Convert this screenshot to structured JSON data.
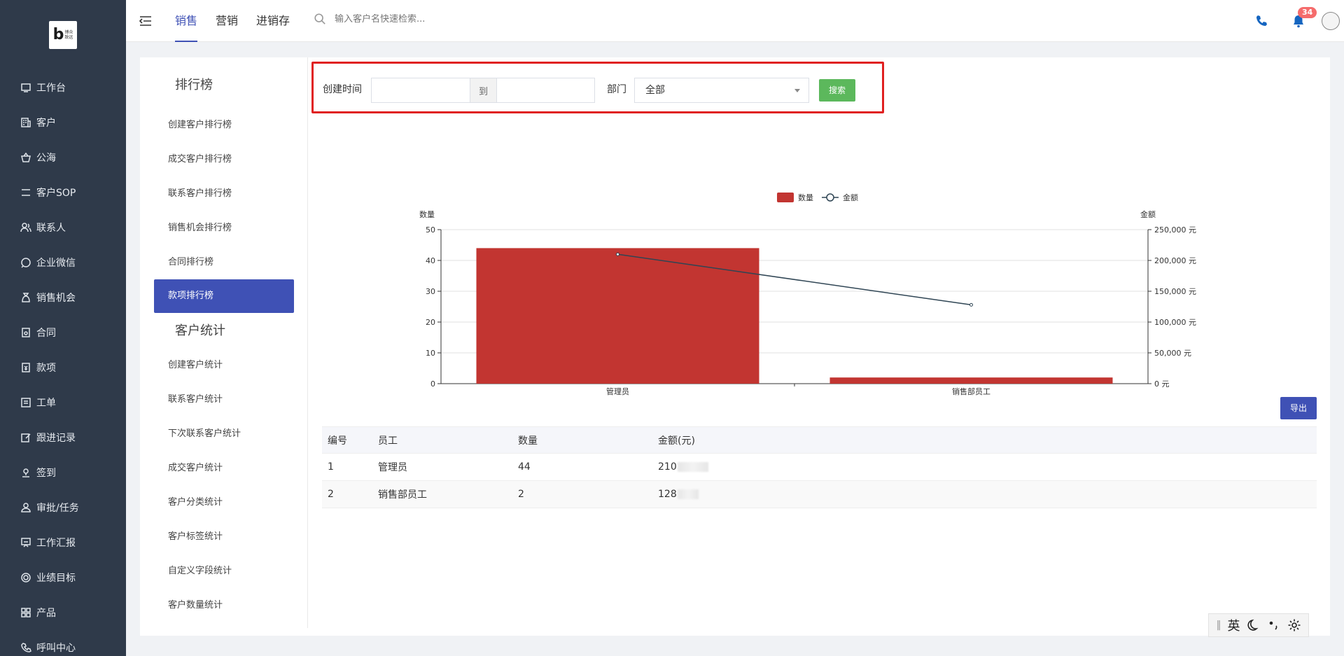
{
  "logo": {
    "text": "博众致远"
  },
  "sidebar": {
    "items": [
      {
        "label": "工作台",
        "icon": "monitor-icon"
      },
      {
        "label": "客户",
        "icon": "building-icon"
      },
      {
        "label": "公海",
        "icon": "basket-icon"
      },
      {
        "label": "客户SOP",
        "icon": "sop-icon"
      },
      {
        "label": "联系人",
        "icon": "contacts-icon"
      },
      {
        "label": "企业微信",
        "icon": "chat-icon"
      },
      {
        "label": "销售机会",
        "icon": "money-bag-icon"
      },
      {
        "label": "合同",
        "icon": "contract-icon"
      },
      {
        "label": "款项",
        "icon": "payment-icon"
      },
      {
        "label": "工单",
        "icon": "ticket-icon"
      },
      {
        "label": "跟进记录",
        "icon": "edit-icon"
      },
      {
        "label": "签到",
        "icon": "location-icon"
      },
      {
        "label": "审批/任务",
        "icon": "approval-icon"
      },
      {
        "label": "工作汇报",
        "icon": "report-icon"
      },
      {
        "label": "业绩目标",
        "icon": "target-icon"
      },
      {
        "label": "产品",
        "icon": "grid-icon"
      },
      {
        "label": "呼叫中心",
        "icon": "phone-icon"
      }
    ]
  },
  "topbar": {
    "tabs": [
      {
        "label": "销售",
        "active": true
      },
      {
        "label": "营销",
        "active": false
      },
      {
        "label": "进销存",
        "active": false
      }
    ],
    "search_placeholder": "输入客户名快速检索...",
    "notification_count": "34"
  },
  "leftmenu": {
    "section1_title": "排行榜",
    "section1_items": [
      "创建客户排行榜",
      "成交客户排行榜",
      "联系客户排行榜",
      "销售机会排行榜",
      "合同排行榜",
      "款项排行榜"
    ],
    "active_item": "款项排行榜",
    "section2_title": "客户统计",
    "section2_items": [
      "创建客户统计",
      "联系客户统计",
      "下次联系客户统计",
      "成交客户统计",
      "客户分类统计",
      "客户标签统计",
      "自定义字段统计",
      "客户数量统计"
    ]
  },
  "filter": {
    "created_time_label": "创建时间",
    "range_separator": "到",
    "start_value": "",
    "end_value": "",
    "department_label": "部门",
    "department_value": "全部",
    "search_button": "搜索"
  },
  "chart_data": {
    "type": "bar",
    "categories": [
      "管理员",
      "销售部员工"
    ],
    "series": [
      {
        "name": "数量",
        "type": "bar",
        "axis": "left",
        "values": [
          44,
          2
        ],
        "color": "#c23531"
      },
      {
        "name": "金额",
        "type": "line",
        "axis": "right",
        "values": [
          210000,
          128000
        ],
        "color": "#2f4554"
      }
    ],
    "y_left": {
      "label": "数量",
      "ticks": [
        "0",
        "10",
        "20",
        "30",
        "40",
        "50"
      ],
      "range": [
        0,
        50
      ]
    },
    "y_right": {
      "label": "金额",
      "ticks": [
        "0 元",
        "50,000 元",
        "100,000 元",
        "150,000 元",
        "200,000 元",
        "250,000 元"
      ],
      "range": [
        0,
        250000
      ]
    },
    "grid": true,
    "legend_position": "top-center"
  },
  "table": {
    "export_button": "导出",
    "headers": [
      "编号",
      "员工",
      "数量",
      "金额(元)"
    ],
    "rows": [
      {
        "id": "1",
        "employee": "管理员",
        "count": "44",
        "amount": "210"
      },
      {
        "id": "2",
        "employee": "销售部员工",
        "count": "2",
        "amount": "128"
      }
    ]
  },
  "ime": {
    "lang": "英"
  }
}
